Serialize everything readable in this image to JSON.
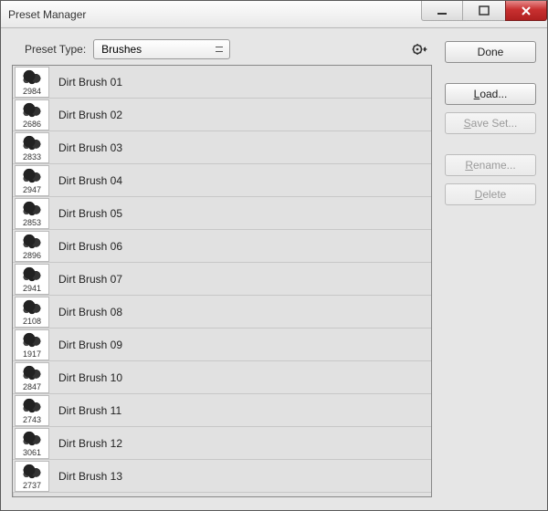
{
  "window": {
    "title": "Preset Manager"
  },
  "presetType": {
    "label": "Preset Type:",
    "value": "Brushes"
  },
  "buttons": {
    "done": "Done",
    "load": "Load...",
    "saveSet": "Save Set...",
    "rename": "Rename...",
    "delete": "Delete"
  },
  "brushes": [
    {
      "size": "2984",
      "name": "Dirt Brush 01"
    },
    {
      "size": "2686",
      "name": "Dirt Brush 02"
    },
    {
      "size": "2833",
      "name": "Dirt Brush 03"
    },
    {
      "size": "2947",
      "name": "Dirt Brush 04"
    },
    {
      "size": "2853",
      "name": "Dirt Brush 05"
    },
    {
      "size": "2896",
      "name": "Dirt Brush 06"
    },
    {
      "size": "2941",
      "name": "Dirt Brush 07"
    },
    {
      "size": "2108",
      "name": "Dirt Brush 08"
    },
    {
      "size": "1917",
      "name": "Dirt Brush 09"
    },
    {
      "size": "2847",
      "name": "Dirt Brush 10"
    },
    {
      "size": "2743",
      "name": "Dirt Brush 11"
    },
    {
      "size": "3061",
      "name": "Dirt Brush 12"
    },
    {
      "size": "2737",
      "name": "Dirt Brush 13"
    }
  ]
}
